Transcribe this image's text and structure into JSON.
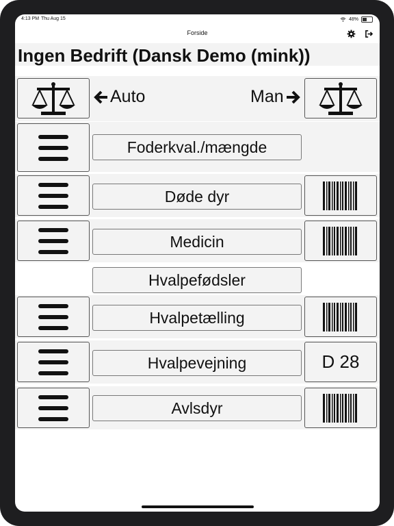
{
  "status": {
    "time": "4:13 PM",
    "date": "Thu Aug 15",
    "battery": "48%"
  },
  "nav": {
    "title": "Forside",
    "settings_icon": "gear-icon",
    "logout_icon": "logout-icon"
  },
  "header": {
    "title": "Ingen Bedrift (Dansk Demo (mink))"
  },
  "scale_row": {
    "auto_label": "Auto",
    "man_label": "Man",
    "icon": "scale-icon"
  },
  "rows": [
    {
      "label": "Foderkval./mængde",
      "right": ""
    },
    {
      "label": "Døde dyr",
      "right": "barcode-icon"
    },
    {
      "label": "Medicin",
      "right": "barcode-icon"
    },
    {
      "label": "Hvalpefødsler",
      "right": ""
    },
    {
      "label": "Hvalpetælling",
      "right": "barcode-icon"
    },
    {
      "label": "Hvalpevejning",
      "right_text": "D 28"
    },
    {
      "label": "Avlsdyr",
      "right": "barcode-icon"
    }
  ]
}
